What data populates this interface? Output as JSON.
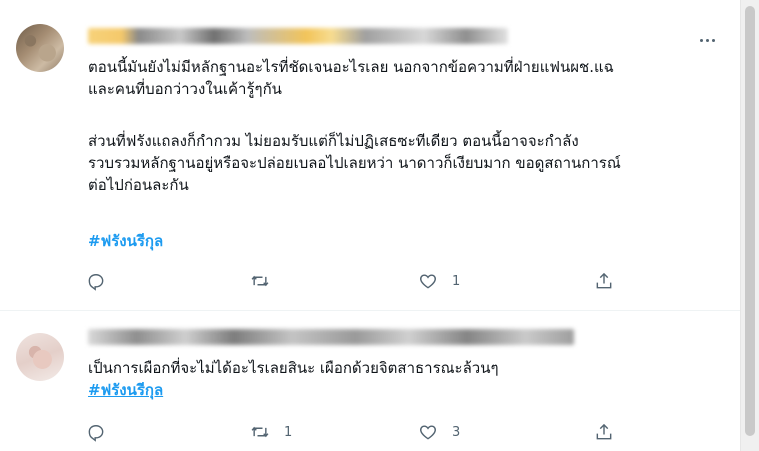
{
  "tweets": [
    {
      "paragraphs": [
        [
          "ตอนนี้มันยังไม่มีหลักฐานอะไรที่ชัดเจนอะไรเลย นอกจากข้อความที่ฝ่ายแฟนผช.แฉ",
          "และคนที่บอกว่าวงในเค้ารู้ๆกัน"
        ],
        [
          "ส่วนที่ฟรังแถลงก็กำกวม ไม่ยอมรับแต่ก็ไม่ปฏิเสธซะทีเดียว ตอนนี้อาจจะกำลัง",
          "รวบรวมหลักฐานอยู่หรือจะปล่อยเบลอไปเลยหว่า นาดาวก็เงียบมาก ขอดูสถานการณ์",
          "ต่อไปก่อนละกัน"
        ]
      ],
      "hashtag": "#ฟรังนรีกุล",
      "actions": {
        "reply_count": "",
        "retweet_count": "",
        "like_count": "1"
      }
    },
    {
      "paragraphs": [
        [
          "เป็นการเผือกที่จะไม่ได้อะไรเลยสินะ เผือกด้วยจิตสาธารณะล้วนๆ"
        ]
      ],
      "hashtag": "#ฟรังนรีกุล",
      "actions": {
        "reply_count": "",
        "retweet_count": "1",
        "like_count": "3"
      }
    }
  ],
  "icons": {
    "more": "more-horizontal-icon",
    "reply": "reply-bubble-icon",
    "retweet": "retweet-icon",
    "like": "heart-icon",
    "share": "share-upload-icon"
  },
  "colors": {
    "text": "#0f1419",
    "muted": "#536471",
    "link": "#1d9bf0",
    "divider": "#eff3f4"
  }
}
